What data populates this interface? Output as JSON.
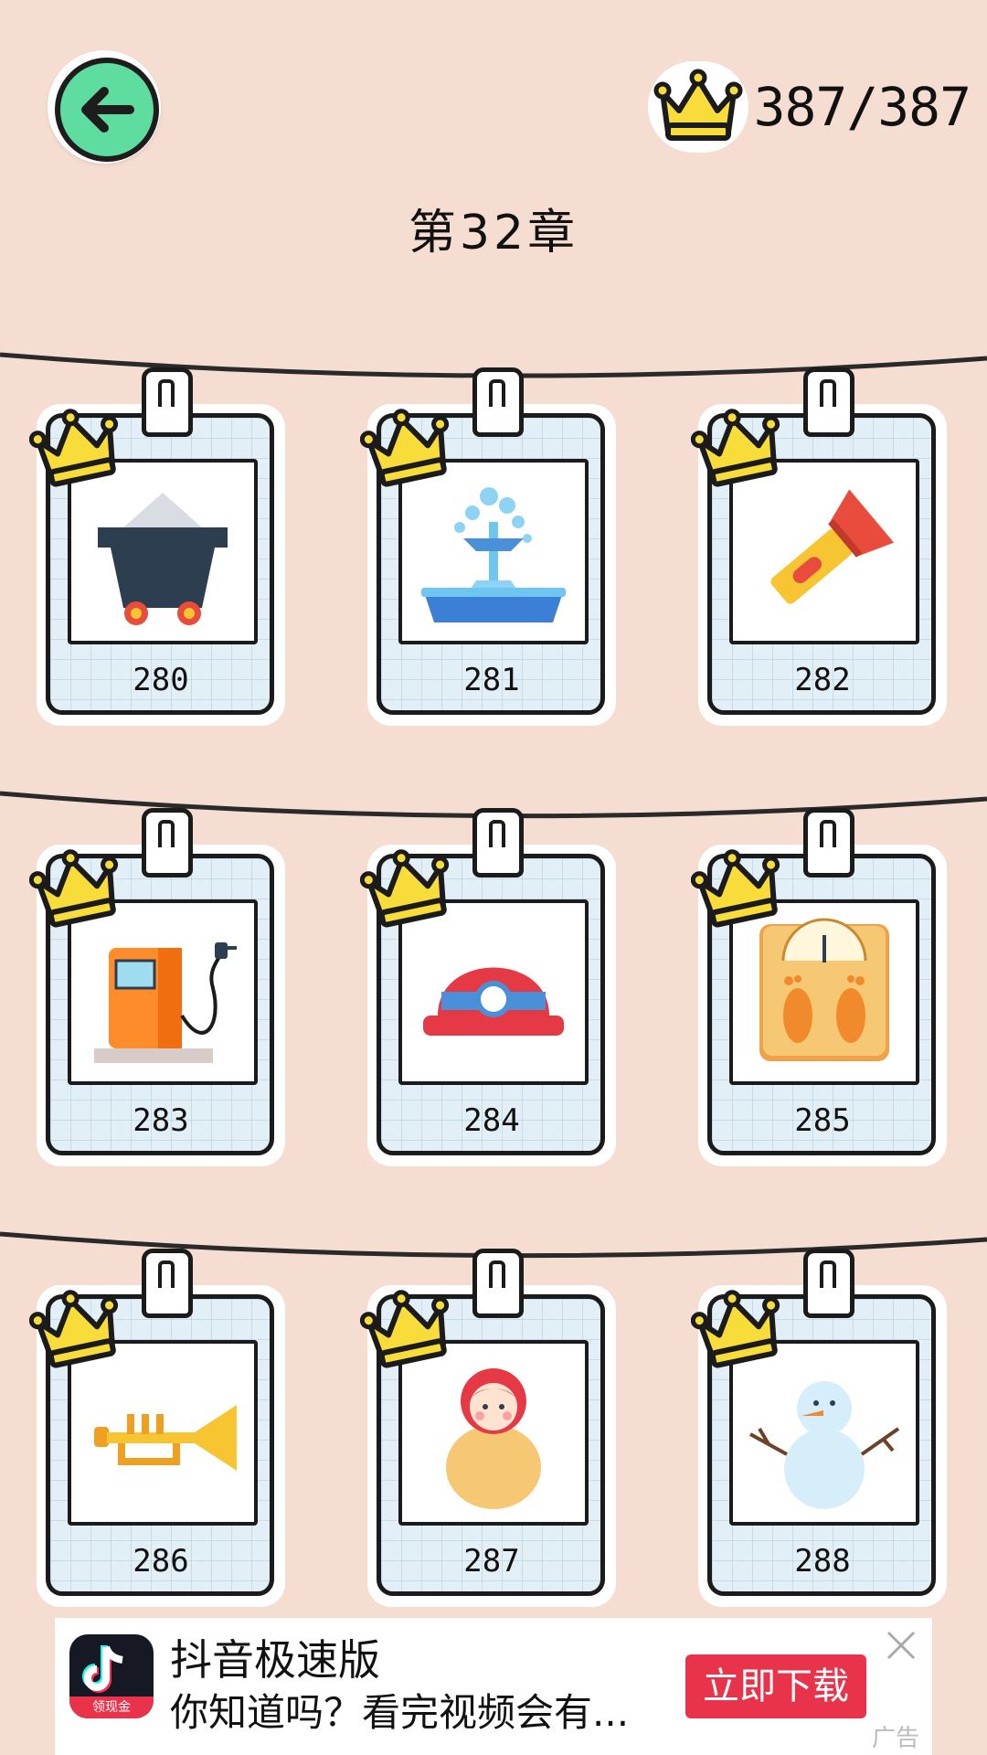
{
  "header": {
    "back_icon": "arrow-left-icon",
    "crown_count": "387/387",
    "chapter_title": "第32章"
  },
  "levels": [
    {
      "number": "280",
      "icon": "mine-cart-icon"
    },
    {
      "number": "281",
      "icon": "fountain-icon"
    },
    {
      "number": "282",
      "icon": "flashlight-icon"
    },
    {
      "number": "283",
      "icon": "gas-pump-icon"
    },
    {
      "number": "284",
      "icon": "miner-helmet-icon"
    },
    {
      "number": "285",
      "icon": "bathroom-scale-icon"
    },
    {
      "number": "286",
      "icon": "trumpet-icon"
    },
    {
      "number": "287",
      "icon": "matryoshka-doll-icon"
    },
    {
      "number": "288",
      "icon": "snowman-icon"
    }
  ],
  "ad": {
    "app_name": "抖音极速版",
    "description": "你知道吗？看完视频会有...",
    "cta": "立即下载",
    "badge": "领现金",
    "label": "广告"
  },
  "colors": {
    "background": "#f6ddd1",
    "back_button": "#5fdc9f",
    "crown": "#f7dc3a",
    "cta": "#e8334a"
  }
}
